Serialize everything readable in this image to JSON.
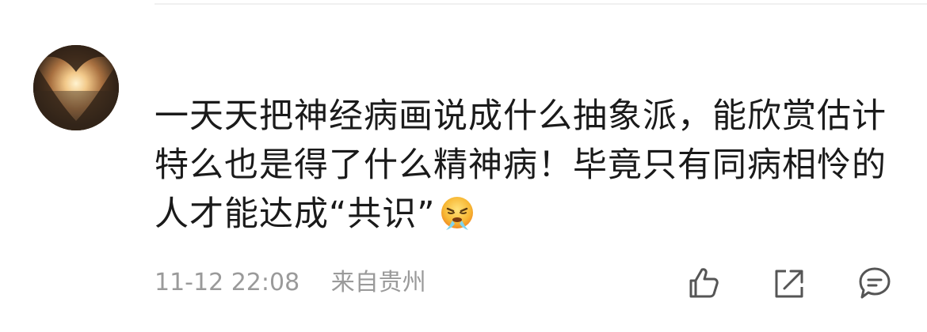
{
  "comment": {
    "text": "一天天把神经病画说成什么抽象派，能欣赏估计特么也是得了什么精神病！毕竟只有同病相怜的人才能达成“共识”",
    "emoji": "steam-from-nose-face",
    "timestamp": "11-12 22:08",
    "location": "来自贵州"
  },
  "actions": {
    "like_icon": "thumbs-up-icon",
    "share_icon": "share-icon",
    "reply_icon": "comment-icon",
    "icon_color": "#555555"
  }
}
